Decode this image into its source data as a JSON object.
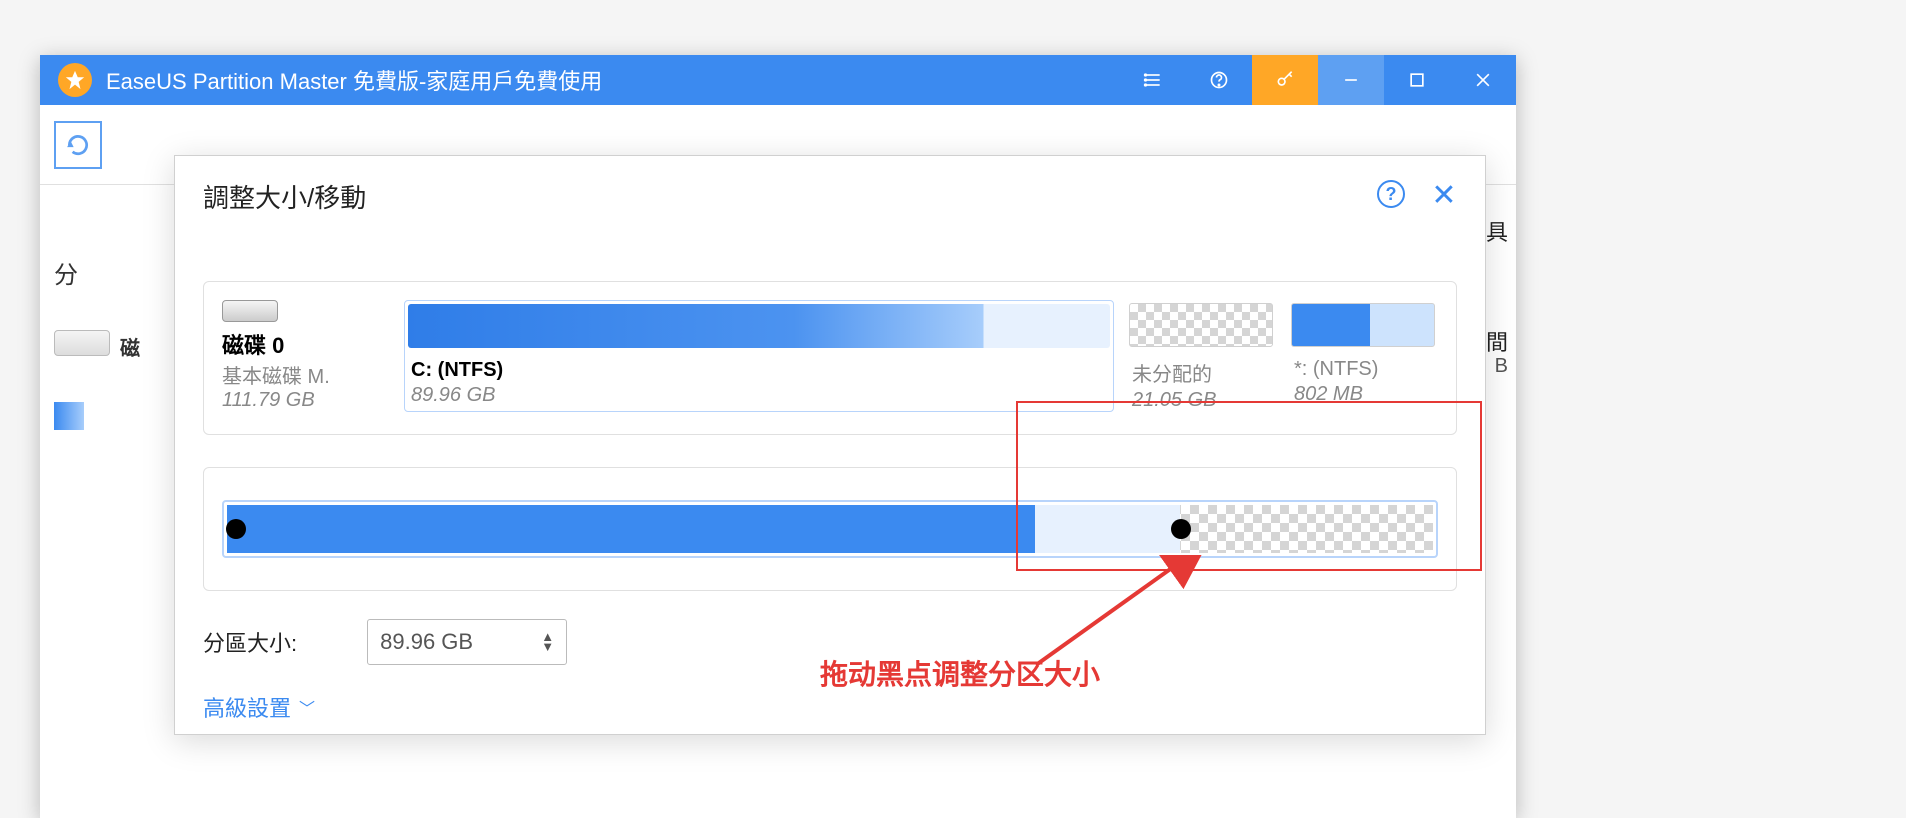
{
  "titlebar": {
    "title": "EaseUS Partition Master 免費版-家庭用戶免費使用"
  },
  "dialog": {
    "title": "調整大小/移動",
    "disk": {
      "name": "磁碟 0",
      "sub": "基本磁碟 M.",
      "size": "111.79 GB"
    },
    "partitions": {
      "c": {
        "name": "C:  (NTFS)",
        "size": "89.96 GB"
      },
      "unalloc": {
        "name": "未分配的",
        "size": "21.05 GB"
      },
      "p2": {
        "name": "*:  (NTFS)",
        "size": "802 MB"
      }
    },
    "size_label": "分區大小:",
    "size_value": "89.96 GB",
    "advanced": "高級設置"
  },
  "side": {
    "label": "磁"
  },
  "right_trunc": {
    "tool": "具",
    "time": "間",
    "b": "B"
  },
  "annotation": {
    "text": "拖动黑点调整分区大小"
  }
}
